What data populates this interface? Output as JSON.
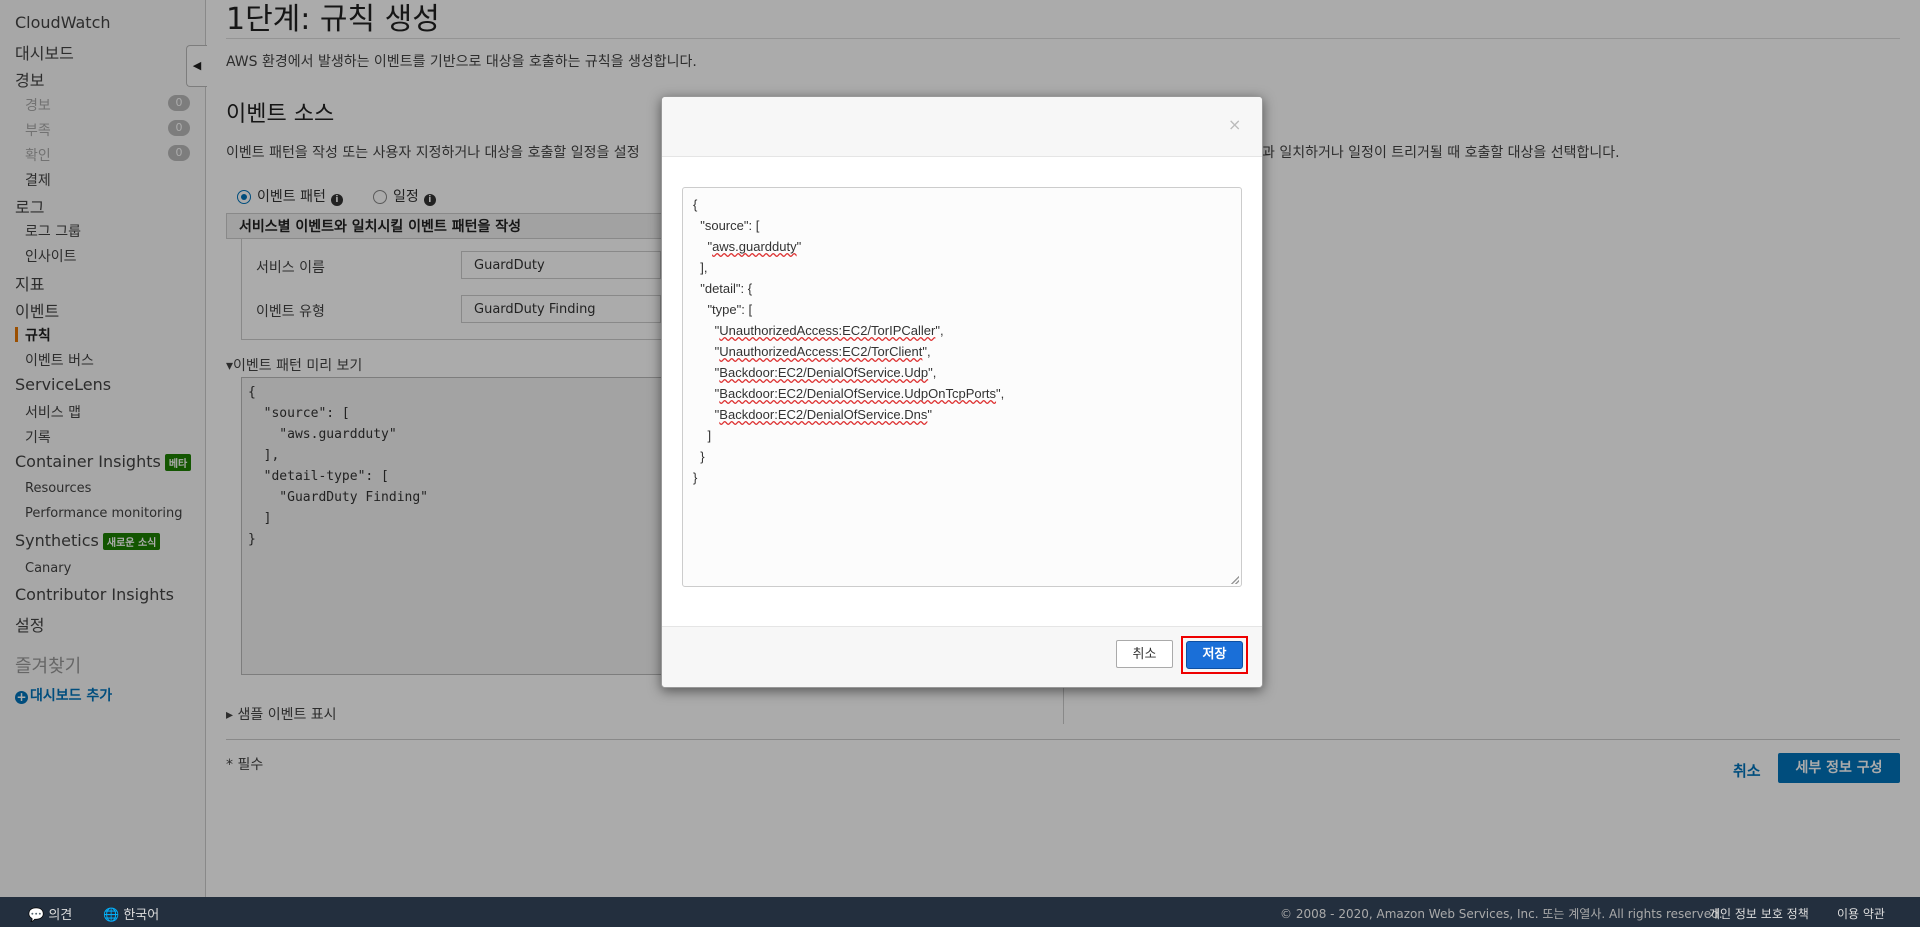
{
  "sidebar": {
    "cloudwatch": "CloudWatch",
    "dashboards": "대시보드",
    "alarms": "경보",
    "alarm_items": [
      {
        "label": "경보",
        "count": "0"
      },
      {
        "label": "부족",
        "count": "0"
      },
      {
        "label": "확인",
        "count": "0"
      }
    ],
    "billing": "결제",
    "logs": "로그",
    "log_groups": "로그 그룹",
    "insights": "인사이트",
    "metrics": "지표",
    "events": "이벤트",
    "rules": "규칙",
    "event_buses": "이벤트 버스",
    "servicelens": "ServiceLens",
    "service_map": "서비스 맵",
    "traces": "기록",
    "container_insights": "Container Insights",
    "container_badge": "베타",
    "resources": "Resources",
    "performance_monitoring": "Performance monitoring",
    "synthetics": "Synthetics",
    "synthetics_badge": "새로운 소식",
    "canary": "Canary",
    "contributor_insights": "Contributor Insights",
    "settings": "설정",
    "favorites": "즐겨찾기",
    "add_dashboard": "대시보드 추가"
  },
  "main": {
    "title": "1단계: 규칙 생성",
    "description": "AWS 환경에서 발생하는 이벤트를 기반으로 대상을 호출하는 규칙을 생성합니다.",
    "event_source_title": "이벤트 소스",
    "event_source_desc": "이벤트 패턴을 작성 또는 사용자 지정하거나 대상을 호출할 일정을 설정",
    "event_source_desc_right": "과 일치하거나 일정이 트리거될 때 호출할 대상을 선택합니다.",
    "radio_event_pattern": "이벤트 패턴",
    "radio_schedule": "일정",
    "panel_title": "서비스별 이벤트와 일치시킬 이벤트 패턴을 작성",
    "service_name_label": "서비스 이름",
    "service_name_value": "GuardDuty",
    "event_type_label": "이벤트 유형",
    "event_type_value": "GuardDuty Finding",
    "preview_label": "이벤트 패턴 미리 보기",
    "preview_code": "{\n  \"source\": [\n    \"aws.guardduty\"\n  ],\n  \"detail-type\": [\n    \"GuardDuty Finding\"\n  ]\n}",
    "sample_events": "샘플 이벤트 표시",
    "required_note": "* 필수",
    "cancel": "취소",
    "configure_details": "세부 정보 구성"
  },
  "modal": {
    "close": "×",
    "editor_lines": [
      "{",
      "  \"source\": [",
      "    \"aws.guardduty\"",
      "  ],",
      "  \"detail\": {",
      "    \"type\": [",
      "      \"UnauthorizedAccess:EC2/TorIPCaller\",",
      "      \"UnauthorizedAccess:EC2/TorClient\",",
      "      \"Backdoor:EC2/DenialOfService.Udp\",",
      "      \"Backdoor:EC2/DenialOfService.UdpOnTcpPorts\",",
      "      \"Backdoor:EC2/DenialOfService.Dns\"",
      "    ]",
      "  }",
      "}"
    ],
    "cancel_button": "취소",
    "save_button": "저장"
  },
  "footer": {
    "feedback": "의견",
    "language": "한국어",
    "copyright": "© 2008 - 2020, Amazon Web Services, Inc. 또는 계열사. All rights reserved.",
    "privacy": "개인 정보 보호 정책",
    "terms": "이용 약관"
  },
  "colors": {
    "accent": "#0073bb",
    "save_button": "#1a6fd8",
    "highlight": "#e00000",
    "footer_bg": "#232f3e",
    "badge": "#1d8102"
  }
}
